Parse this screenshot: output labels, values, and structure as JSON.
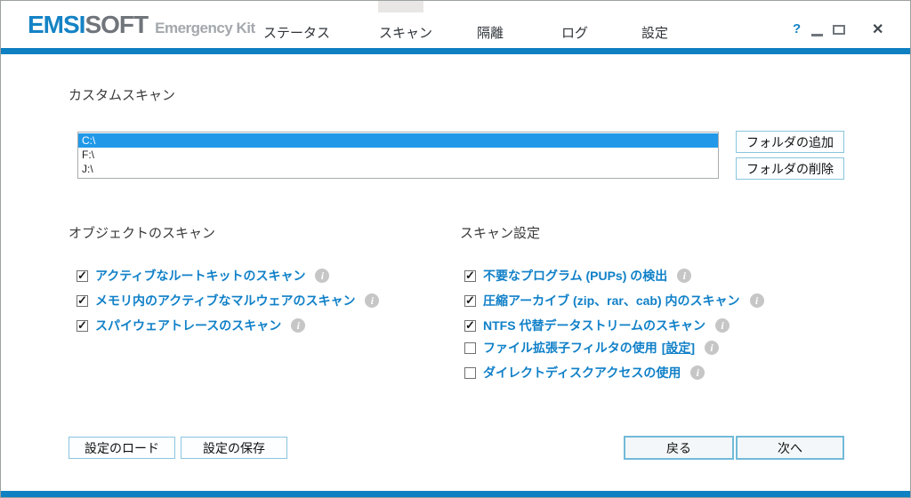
{
  "colors": {
    "brand_blue": "#1583C5",
    "bar_blue": "#0F80C1",
    "label_blue": "#1080C8",
    "selection_blue": "#2199E8"
  },
  "titlebar": {
    "logo": {
      "primary": "EMSI",
      "secondary": "SOFT",
      "subtitle": "Emergency Kit"
    },
    "nav": [
      {
        "label": "ステータス",
        "active": false
      },
      {
        "label": "スキャン",
        "active": true
      },
      {
        "label": "隔離",
        "active": false
      },
      {
        "label": "ログ",
        "active": false
      },
      {
        "label": "設定",
        "active": false
      }
    ],
    "controls": {
      "help": "?",
      "close": "✕"
    }
  },
  "custom_scan": {
    "title": "カスタムスキャン",
    "drives": [
      {
        "label": "C:\\",
        "selected": true
      },
      {
        "label": "F:\\",
        "selected": false
      },
      {
        "label": "J:\\",
        "selected": false
      }
    ],
    "add_folder": "フォルダの追加",
    "remove_folder": "フォルダの削除"
  },
  "scan_objects": {
    "title": "オブジェクトのスキャン",
    "options": [
      {
        "label": "アクティブなルートキットのスキャン",
        "checked": true
      },
      {
        "label": "メモリ内のアクティブなマルウェアのスキャン",
        "checked": true
      },
      {
        "label": "スパイウェアトレースのスキャン",
        "checked": true
      }
    ]
  },
  "scan_settings": {
    "title": "スキャン設定",
    "options": [
      {
        "label": "不要なプログラム (PUPs) の検出",
        "checked": true
      },
      {
        "label": "圧縮アーカイブ (zip、rar、cab) 内のスキャン",
        "checked": true
      },
      {
        "label": "NTFS 代替データストリームのスキャン",
        "checked": true
      },
      {
        "label": "ファイル拡張子フィルタの使用",
        "checked": false,
        "link_open": "[",
        "link_label": "設定",
        "link_close": "]"
      },
      {
        "label": "ダイレクトディスクアクセスの使用",
        "checked": false
      }
    ]
  },
  "footer": {
    "load": "設定のロード",
    "save": "設定の保存",
    "back": "戻る",
    "next": "次へ"
  },
  "icons": {
    "info": "i"
  }
}
